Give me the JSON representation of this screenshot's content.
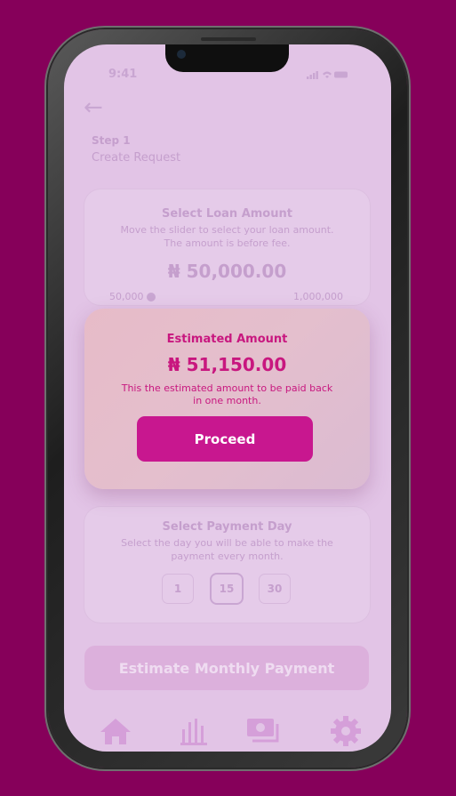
{
  "status_bar": {
    "time": "9:41"
  },
  "header": {
    "back_icon": "arrow-left-icon",
    "step_label": "Step 1",
    "step_title": "Create Request"
  },
  "loan_card": {
    "title": "Select Loan Amount",
    "description": "Move the slider to select your loan amount. The amount is before fee.",
    "amount": "₦ 50,000.00",
    "slider_min": "50,000",
    "slider_max": "1,000,000"
  },
  "payment_card": {
    "title": "Select Payment Day",
    "description": "Select the day you will be able to make the payment every month.",
    "days": [
      "1",
      "15",
      "30"
    ],
    "selected_day": "15"
  },
  "estimate_button": "Estimate Monthly Payment",
  "tabbar": [
    "home-icon",
    "bar-chart-icon",
    "cash-icon",
    "settings-icon"
  ],
  "modal": {
    "title": "Estimated Amount",
    "amount": "₦ 51,150.00",
    "description": "This the estimated amount to be paid back in one month.",
    "proceed_label": "Proceed"
  },
  "colors": {
    "background": "#86005a",
    "accent": "#c8178f",
    "modal_text": "#c8177f"
  }
}
